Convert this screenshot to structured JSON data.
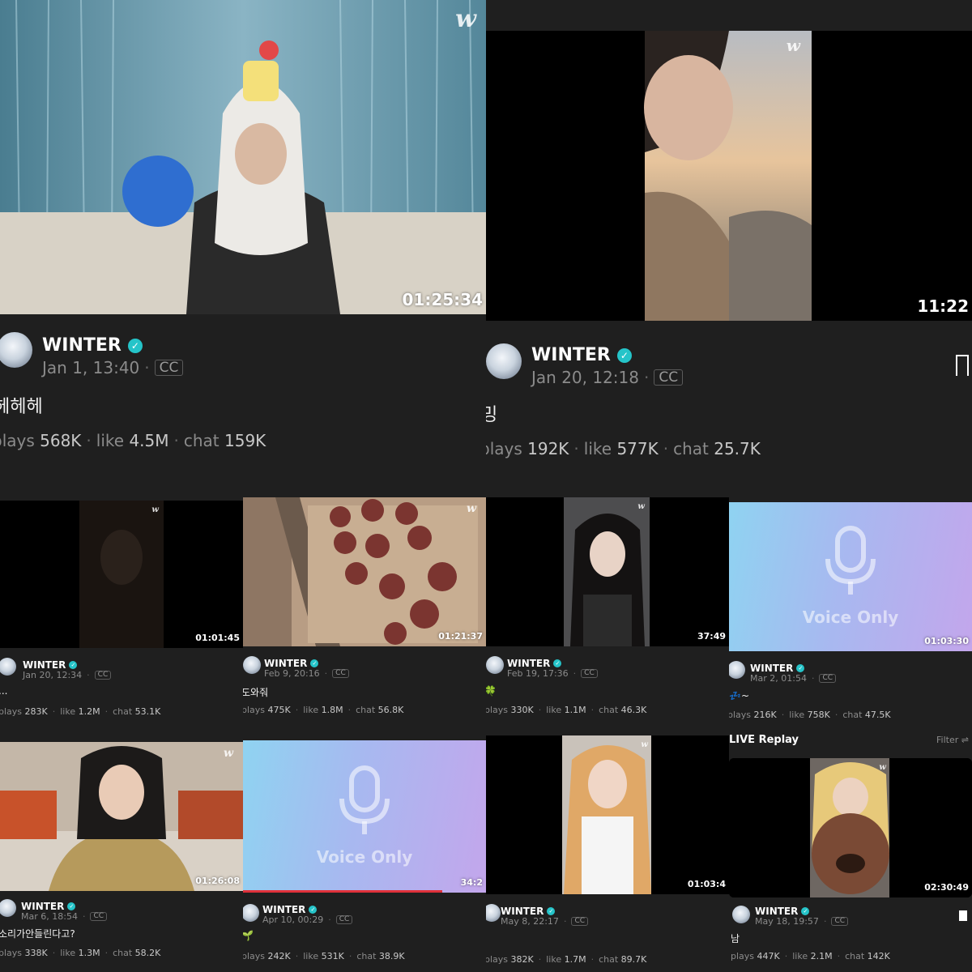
{
  "posts": [
    {
      "name": "WINTER",
      "date": "Jan 1, 13:40",
      "cc": "CC",
      "caption": "헤헤헤",
      "duration": "01:25:34",
      "plays_label": "plays",
      "plays": "568K",
      "like_label": "like",
      "likes": "4.5M",
      "chat_label": "chat",
      "chats": "159K"
    },
    {
      "name": "WINTER",
      "date": "Jan 20, 12:18",
      "cc": "CC",
      "caption": "밍",
      "duration": "11:22",
      "plays_label": "plays",
      "plays": "192K",
      "like_label": "like",
      "likes": "577K",
      "chat_label": "chat",
      "chats": "25.7K"
    },
    {
      "name": "WINTER",
      "date": "Jan 20, 12:34",
      "cc": "CC",
      "caption": "...",
      "duration": "01:01:45",
      "plays_label": "plays",
      "plays": "283K",
      "like_label": "like",
      "likes": "1.2M",
      "chat_label": "chat",
      "chats": "53.1K"
    },
    {
      "name": "WINTER",
      "date": "Feb 9, 20:16",
      "cc": "CC",
      "caption": "도와줘",
      "duration": "01:21:37",
      "plays_label": "plays",
      "plays": "475K",
      "like_label": "like",
      "likes": "1.8M",
      "chat_label": "chat",
      "chats": "56.8K"
    },
    {
      "name": "WINTER",
      "date": "Feb 19, 17:36",
      "cc": "CC",
      "caption": "🍀",
      "duration": "37:49",
      "plays_label": "plays",
      "plays": "330K",
      "like_label": "like",
      "likes": "1.1M",
      "chat_label": "chat",
      "chats": "46.3K"
    },
    {
      "name": "WINTER",
      "date": "Mar 2, 01:54",
      "cc": "CC",
      "caption": "💤~",
      "duration": "01:03:30",
      "plays_label": "plays",
      "plays": "216K",
      "like_label": "like",
      "likes": "758K",
      "chat_label": "chat",
      "chats": "47.5K",
      "voice_label": "Voice Only"
    },
    {
      "name": "WINTER",
      "date": "Mar 6, 18:54",
      "cc": "CC",
      "caption": "소리가안들린다고?",
      "duration": "01:26:08",
      "plays_label": "plays",
      "plays": "338K",
      "like_label": "like",
      "likes": "1.3M",
      "chat_label": "chat",
      "chats": "58.2K"
    },
    {
      "name": "WINTER",
      "date": "Apr 10, 00:29",
      "cc": "CC",
      "caption": "🌱",
      "duration": "34:2",
      "plays_label": "plays",
      "plays": "242K",
      "like_label": "like",
      "likes": "531K",
      "chat_label": "chat",
      "chats": "38.9K",
      "voice_label": "Voice Only"
    },
    {
      "name": "WINTER",
      "date": "May 8, 22:17",
      "cc": "CC",
      "caption": "",
      "duration": "01:03:4",
      "plays_label": "plays",
      "plays": "382K",
      "like_label": "like",
      "likes": "1.7M",
      "chat_label": "chat",
      "chats": "89.7K"
    },
    {
      "name": "WINTER",
      "date": "May 18, 19:57",
      "cc": "CC",
      "caption": "남",
      "duration": "02:30:49",
      "plays_label": "plays",
      "plays": "447K",
      "like_label": "like",
      "likes": "2.1M",
      "chat_label": "chat",
      "chats": "142K"
    }
  ],
  "live_replay": {
    "title": "LIVE Replay",
    "filter": "Filter ⇌"
  },
  "logo": "w",
  "colors": {
    "verified": "#25c4c9",
    "background": "#1f1f1f",
    "progress": "#e0313a"
  }
}
